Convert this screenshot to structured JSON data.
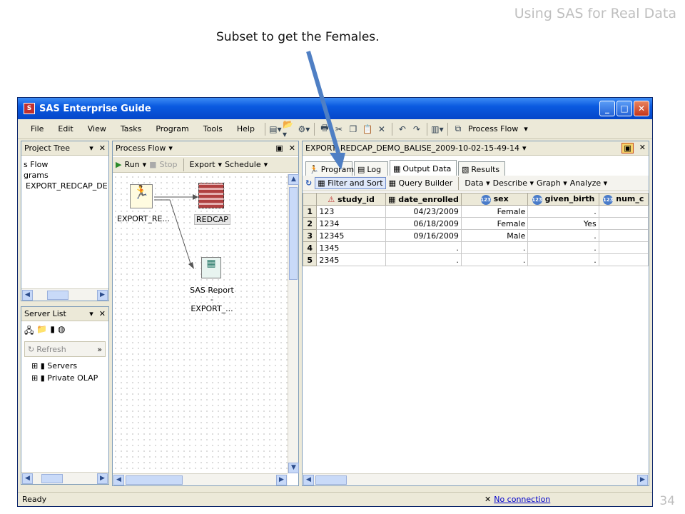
{
  "slide": {
    "title": "Using SAS for Real Data",
    "caption": "Subset to get the Females.",
    "page_number": "34"
  },
  "window": {
    "title": "SAS Enterprise Guide"
  },
  "menus": [
    "File",
    "Edit",
    "View",
    "Tasks",
    "Program",
    "Tools",
    "Help"
  ],
  "toolbar": {
    "process_flow_label": "Process Flow"
  },
  "project_tree": {
    "title": "Project Tree",
    "items": [
      "s Flow",
      "grams",
      "EXPORT_REDCAP_DE"
    ]
  },
  "server_list": {
    "title": "Server List",
    "refresh_label": "Refresh",
    "items": [
      "Servers",
      "Private OLAP"
    ]
  },
  "process_flow": {
    "title": "Process Flow",
    "run_label": "Run",
    "stop_label": "Stop",
    "export_label": "Export",
    "schedule_label": "Schedule",
    "nodes": {
      "export": "EXPORT_RE...",
      "redcap": "REDCAP",
      "report_line1": "SAS Report",
      "report_line2": "- EXPORT_..."
    }
  },
  "document": {
    "title": "EXPORT_REDCAP_DEMO_BALISE_2009-10-02-15-49-14",
    "tabs": [
      "Program",
      "Log",
      "Output Data",
      "Results"
    ],
    "active_tab": "Output Data",
    "toolbar": [
      "Filter and Sort",
      "Query Builder",
      "Data",
      "Describe",
      "Graph",
      "Analyze"
    ]
  },
  "table": {
    "columns": [
      "study_id",
      "date_enrolled",
      "sex",
      "given_birth",
      "num_c"
    ],
    "rows": [
      {
        "n": "1",
        "study_id": "123",
        "date_enrolled": "04/23/2009",
        "sex": "Female",
        "given_birth": ".",
        "num_c": ""
      },
      {
        "n": "2",
        "study_id": "1234",
        "date_enrolled": "06/18/2009",
        "sex": "Female",
        "given_birth": "Yes",
        "num_c": ""
      },
      {
        "n": "3",
        "study_id": "12345",
        "date_enrolled": "09/16/2009",
        "sex": "Male",
        "given_birth": ".",
        "num_c": ""
      },
      {
        "n": "4",
        "study_id": "1345",
        "date_enrolled": ".",
        "sex": ".",
        "given_birth": ".",
        "num_c": ""
      },
      {
        "n": "5",
        "study_id": "2345",
        "date_enrolled": ".",
        "sex": ".",
        "given_birth": ".",
        "num_c": ""
      }
    ]
  },
  "status": {
    "ready": "Ready",
    "connection": "No connection"
  }
}
